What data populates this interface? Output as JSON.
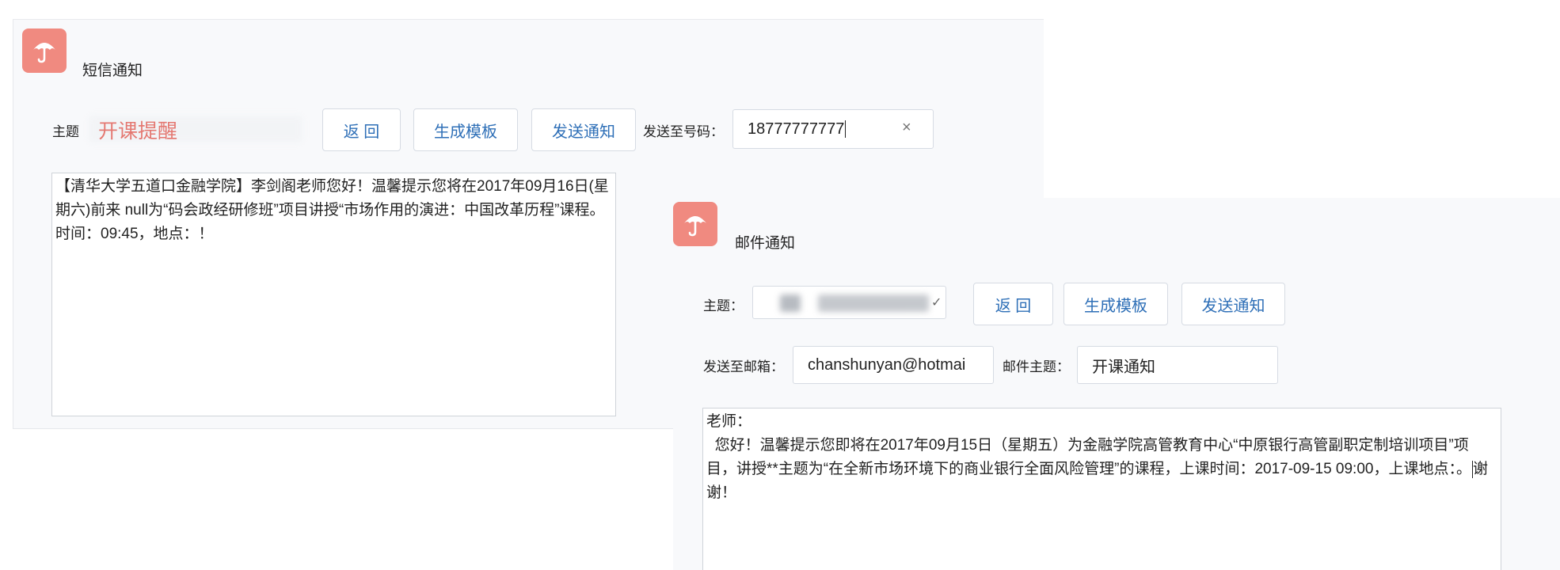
{
  "sms": {
    "title": "短信通知",
    "subject_label": "主题",
    "subject_value": "开课提醒",
    "buttons": {
      "back": "返 回",
      "template": "生成模板",
      "send": "发送通知"
    },
    "send_to_label": "发送至号码：",
    "phone_value": "18777777777",
    "clear_icon": "close-icon",
    "body_text": "【清华大学五道口金融学院】李剑阁老师您好！温馨提示您将在2017年09月16日(星期六)前来 null为“码会政经研修班”项目讲授“市场作用的演进：中国改革历程”课程。时间：09:45，地点：！"
  },
  "mail": {
    "title": "邮件通知",
    "subject_label": "主题：",
    "buttons": {
      "back": "返 回",
      "template": "生成模板",
      "send": "发送通知"
    },
    "to_label": "发送至邮箱：",
    "to_value": "chanshunyan@hotmai",
    "mail_subject_label": "邮件主题：",
    "mail_subject_value": "开课通知",
    "body_greeting": "老师：",
    "body_text_before_caret": "  您好！温馨提示您即将在2017年09月15日（星期五）为金融学院高管教育中心“中原银行高管副职定制培训项目”项目，讲授**主题为“在全新市场环境下的商业银行全面风险管理”的课程，上课时间：2017-09-15 09:00，上课地点：。",
    "body_text_after_caret": "谢谢！"
  },
  "icons": {
    "app": "umbrella-icon",
    "dropdown": "chevron-down-icon"
  },
  "colors": {
    "accent": "#2e6fb7",
    "icon_bg": "#f08a80",
    "subject_red": "#e23b2e"
  }
}
